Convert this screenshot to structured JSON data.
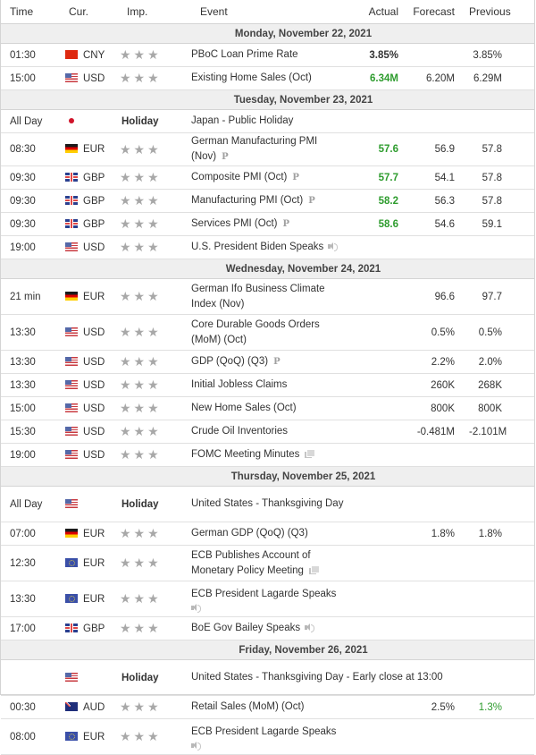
{
  "header": {
    "time": "Time",
    "currency": "Cur.",
    "importance": "Imp.",
    "event": "Event",
    "actual": "Actual",
    "forecast": "Forecast",
    "previous": "Previous"
  },
  "colors": {
    "better_than_expected": "#2e9c2e",
    "day_header_bg": "#efefef",
    "star_inactive": "#a8a8a8"
  },
  "days": [
    {
      "label": "Monday, November 22, 2021",
      "events": [
        {
          "time": "01:30",
          "flag": "china-flag-icon",
          "currency": "CNY",
          "stars": "★★★",
          "event": "PBoC Loan Prime Rate",
          "actual": "3.85%",
          "actual_color": "dark",
          "forecast": "",
          "previous": "3.85%"
        },
        {
          "time": "15:00",
          "flag": "us-flag-icon",
          "currency": "USD",
          "stars": "★★★",
          "event": "Existing Home Sales (Oct)",
          "actual": "6.34M",
          "actual_color": "green",
          "forecast": "6.20M",
          "previous": "6.29M"
        }
      ]
    },
    {
      "label": "Tuesday, November 23, 2021",
      "events": [
        {
          "time": "All Day",
          "flag": "japan-flag-icon",
          "currency": "",
          "holiday": "Holiday",
          "event": "Japan - Public Holiday"
        },
        {
          "time": "08:30",
          "flag": "germany-flag-icon",
          "currency": "EUR",
          "stars": "★★★",
          "event": "German Manufacturing PMI (Nov)",
          "icon": "preliminary-icon",
          "icon_glyph": "P",
          "actual": "57.6",
          "actual_color": "green",
          "forecast": "56.9",
          "previous": "57.8"
        },
        {
          "time": "09:30",
          "flag": "uk-flag-icon",
          "currency": "GBP",
          "stars": "★★★",
          "event": "Composite PMI (Oct)",
          "icon": "preliminary-icon",
          "icon_glyph": "P",
          "actual": "57.7",
          "actual_color": "green",
          "forecast": "54.1",
          "previous": "57.8"
        },
        {
          "time": "09:30",
          "flag": "uk-flag-icon",
          "currency": "GBP",
          "stars": "★★★",
          "event": "Manufacturing PMI (Oct)",
          "icon": "preliminary-icon",
          "icon_glyph": "P",
          "actual": "58.2",
          "actual_color": "green",
          "forecast": "56.3",
          "previous": "57.8"
        },
        {
          "time": "09:30",
          "flag": "uk-flag-icon",
          "currency": "GBP",
          "stars": "★★★",
          "event": "Services PMI (Oct)",
          "icon": "preliminary-icon",
          "icon_glyph": "P",
          "actual": "58.6",
          "actual_color": "green",
          "forecast": "54.6",
          "previous": "59.1"
        },
        {
          "time": "19:00",
          "flag": "us-flag-icon",
          "currency": "USD",
          "stars": "★★★",
          "event": "U.S. President Biden Speaks",
          "icon": "speaker-icon"
        }
      ]
    },
    {
      "label": "Wednesday, November 24, 2021",
      "events": [
        {
          "time": "21 min",
          "flag": "germany-flag-icon",
          "currency": "EUR",
          "stars": "★★★",
          "event": "German Ifo Business Climate Index (Nov)",
          "actual": "",
          "forecast": "96.6",
          "previous": "97.7"
        },
        {
          "time": "13:30",
          "flag": "us-flag-icon",
          "currency": "USD",
          "stars": "★★★",
          "event": "Core Durable Goods Orders (MoM) (Oct)",
          "actual": "",
          "forecast": "0.5%",
          "previous": "0.5%"
        },
        {
          "time": "13:30",
          "flag": "us-flag-icon",
          "currency": "USD",
          "stars": "★★★",
          "event": "GDP (QoQ) (Q3)",
          "icon": "preliminary-icon",
          "icon_glyph": "P",
          "actual": "",
          "forecast": "2.2%",
          "previous": "2.0%"
        },
        {
          "time": "13:30",
          "flag": "us-flag-icon",
          "currency": "USD",
          "stars": "★★★",
          "event": "Initial Jobless Claims",
          "actual": "",
          "forecast": "260K",
          "previous": "268K"
        },
        {
          "time": "15:00",
          "flag": "us-flag-icon",
          "currency": "USD",
          "stars": "★★★",
          "event": "New Home Sales (Oct)",
          "actual": "",
          "forecast": "800K",
          "previous": "800K"
        },
        {
          "time": "15:30",
          "flag": "us-flag-icon",
          "currency": "USD",
          "stars": "★★★",
          "event": "Crude Oil Inventories",
          "actual": "",
          "forecast": "-0.481M",
          "previous": "-2.101M"
        },
        {
          "time": "19:00",
          "flag": "us-flag-icon",
          "currency": "USD",
          "stars": "★★★",
          "event": "FOMC Meeting Minutes",
          "icon": "document-icon"
        }
      ]
    },
    {
      "label": "Thursday, November 25, 2021",
      "events": [
        {
          "time": "All Day",
          "flag": "us-flag-icon",
          "currency": "",
          "holiday": "Holiday",
          "event": "United States - Thanksgiving Day"
        },
        {
          "time": "07:00",
          "flag": "germany-flag-icon",
          "currency": "EUR",
          "stars": "★★★",
          "event": "German GDP (QoQ) (Q3)",
          "actual": "",
          "forecast": "1.8%",
          "previous": "1.8%"
        },
        {
          "time": "12:30",
          "flag": "eu-flag-icon",
          "currency": "EUR",
          "stars": "★★★",
          "event": "ECB Publishes Account of Monetary Policy Meeting",
          "icon": "document-icon"
        },
        {
          "time": "13:30",
          "flag": "eu-flag-icon",
          "currency": "EUR",
          "stars": "★★★",
          "event": "ECB President Lagarde Speaks",
          "icon": "speaker-icon",
          "icon_block": true
        },
        {
          "time": "17:00",
          "flag": "uk-flag-icon",
          "currency": "GBP",
          "stars": "★★★",
          "event": "BoE Gov Bailey Speaks",
          "icon": "speaker-icon"
        }
      ]
    },
    {
      "label": "Friday, November 26, 2021",
      "events": [
        {
          "time": "",
          "flag": "us-flag-icon",
          "currency": "",
          "holiday": "Holiday",
          "event": "United States - Thanksgiving Day - Early close at 13:00"
        },
        {
          "time": "00:30",
          "flag": "australia-flag-icon",
          "currency": "AUD",
          "stars": "★★★",
          "event": "Retail Sales (MoM) (Oct)",
          "actual": "",
          "forecast": "2.5%",
          "previous": "1.3%",
          "previous_color": "green"
        },
        {
          "time": "08:00",
          "flag": "eu-flag-icon",
          "currency": "EUR",
          "stars": "★★★",
          "event": "ECB President Lagarde Speaks",
          "icon": "speaker-icon",
          "icon_block": true
        }
      ]
    }
  ]
}
